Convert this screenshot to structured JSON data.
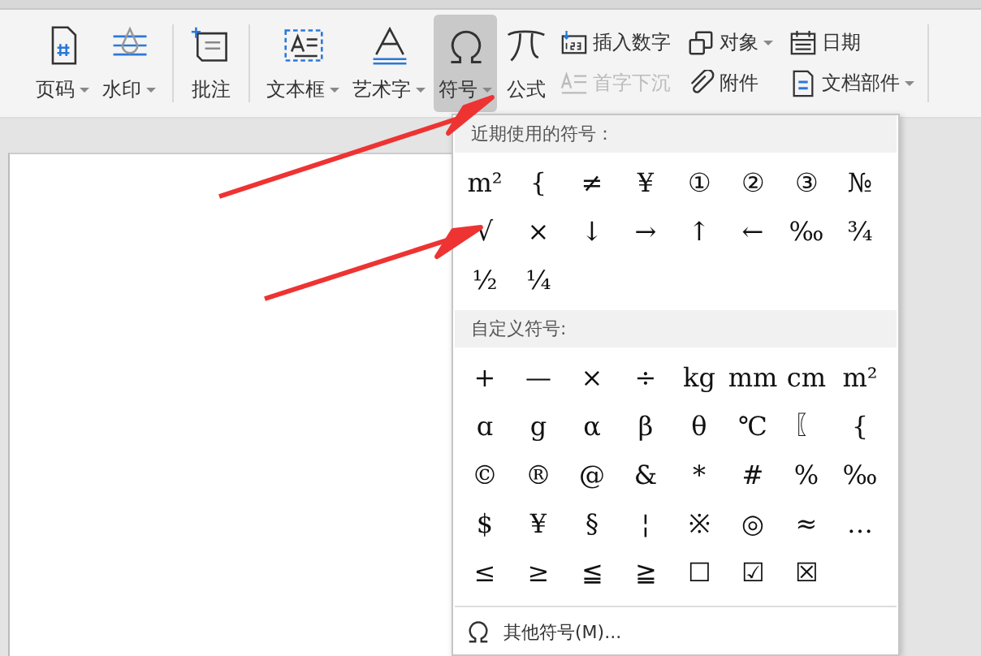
{
  "toolbar": {
    "large_buttons": [
      {
        "label": "页码",
        "dropdown": true,
        "selected": false
      },
      {
        "label": "水印",
        "dropdown": true,
        "selected": false
      },
      {
        "label": "批注",
        "dropdown": false,
        "selected": false
      },
      {
        "label": "文本框",
        "dropdown": true,
        "selected": false
      },
      {
        "label": "艺术字",
        "dropdown": true,
        "selected": false
      },
      {
        "label": "符号",
        "dropdown": true,
        "selected": true
      },
      {
        "label": "公式",
        "dropdown": false,
        "selected": false
      }
    ],
    "small_buttons": [
      {
        "label": "插入数字",
        "dropdown": false,
        "disabled": false
      },
      {
        "label": "首字下沉",
        "dropdown": false,
        "disabled": true
      },
      {
        "label": "对象",
        "dropdown": true,
        "disabled": false
      },
      {
        "label": "附件",
        "dropdown": false,
        "disabled": false
      },
      {
        "label": "日期",
        "dropdown": false,
        "disabled": false
      },
      {
        "label": "文档部件",
        "dropdown": true,
        "disabled": false
      }
    ]
  },
  "symbol_menu": {
    "recent": {
      "title": "近期使用的符号：",
      "symbols": [
        "m²",
        "{",
        "≠",
        "¥",
        "①",
        "②",
        "③",
        "№",
        "√",
        "×",
        "↓",
        "→",
        "↑",
        "←",
        "‰",
        "¾",
        "½",
        "¼"
      ]
    },
    "custom": {
      "title": "自定义符号:",
      "symbols": [
        "+",
        "—",
        "×",
        "÷",
        "kg",
        "mm",
        "cm",
        "m²",
        "ɑ",
        "g",
        "α",
        "β",
        "θ",
        "℃",
        "〖",
        "{",
        "©",
        "®",
        "@",
        "&",
        "*",
        "#",
        "%",
        "‰",
        "$",
        "¥",
        "§",
        "¦",
        "※",
        "◎",
        "≈",
        "…",
        "≤",
        "≥",
        "≦",
        "≧",
        "☐",
        "☑",
        "☒"
      ]
    },
    "more": "其他符号(M)..."
  }
}
